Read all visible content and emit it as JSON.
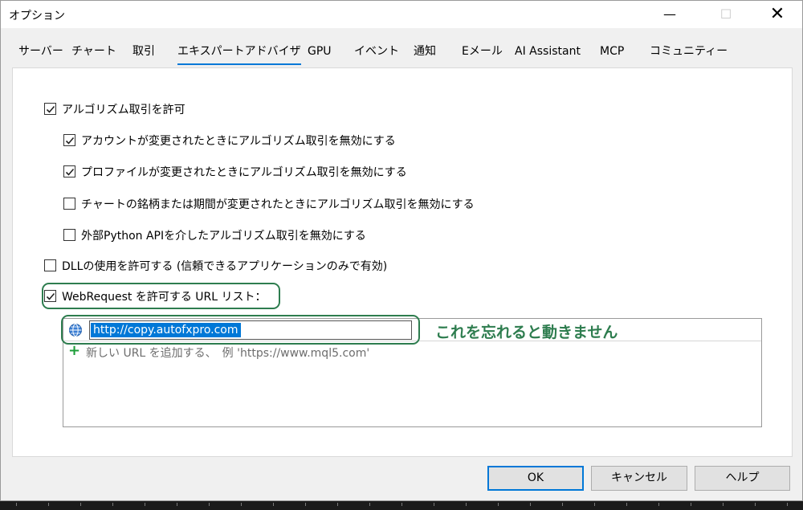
{
  "window": {
    "title": "オプション",
    "minimize_glyph": "—",
    "maximize_glyph": "☐",
    "close_glyph": "✕"
  },
  "tabs": [
    {
      "label": "サーバー",
      "active": false
    },
    {
      "label": "チャート",
      "active": false
    },
    {
      "label": "取引",
      "active": false
    },
    {
      "label": "エキスパートアドバイザ",
      "active": true
    },
    {
      "label": "GPU",
      "active": false
    },
    {
      "label": "イベント",
      "active": false
    },
    {
      "label": "通知",
      "active": false
    },
    {
      "label": "Eメール",
      "active": false
    },
    {
      "label": "AI Assistant",
      "active": false
    },
    {
      "label": "MCP",
      "active": false
    },
    {
      "label": "コミュニティー",
      "active": false
    }
  ],
  "options": [
    {
      "label": "アルゴリズム取引を許可",
      "checked": true
    },
    {
      "label": "アカウントが変更されたときにアルゴリズム取引を無効にする",
      "checked": true
    },
    {
      "label": "プロファイルが変更されたときにアルゴリズム取引を無効にする",
      "checked": true
    },
    {
      "label": "チャートの銘柄または期間が変更されたときにアルゴリズム取引を無効にする",
      "checked": false
    },
    {
      "label": "外部Python APIを介したアルゴリズム取引を無効にする",
      "checked": false
    },
    {
      "label": "DLLの使用を許可する (信頼できるアプリケーションのみで有効)",
      "checked": false
    },
    {
      "label": "WebRequest を許可する URL リスト：",
      "checked": true
    }
  ],
  "url_list": {
    "entries": [
      "http://copy.autofxpro.com"
    ],
    "add_placeholder": "新しい URL を追加する、　例 'https://www.mql5.com'"
  },
  "annotation": "これを忘れると動きません",
  "buttons": {
    "ok": "OK",
    "cancel": "キャンセル",
    "help": "ヘルプ"
  },
  "colors": {
    "accent": "#0078d7",
    "annotation": "#2e7d4f",
    "add_icon": "#1e9e3a"
  }
}
